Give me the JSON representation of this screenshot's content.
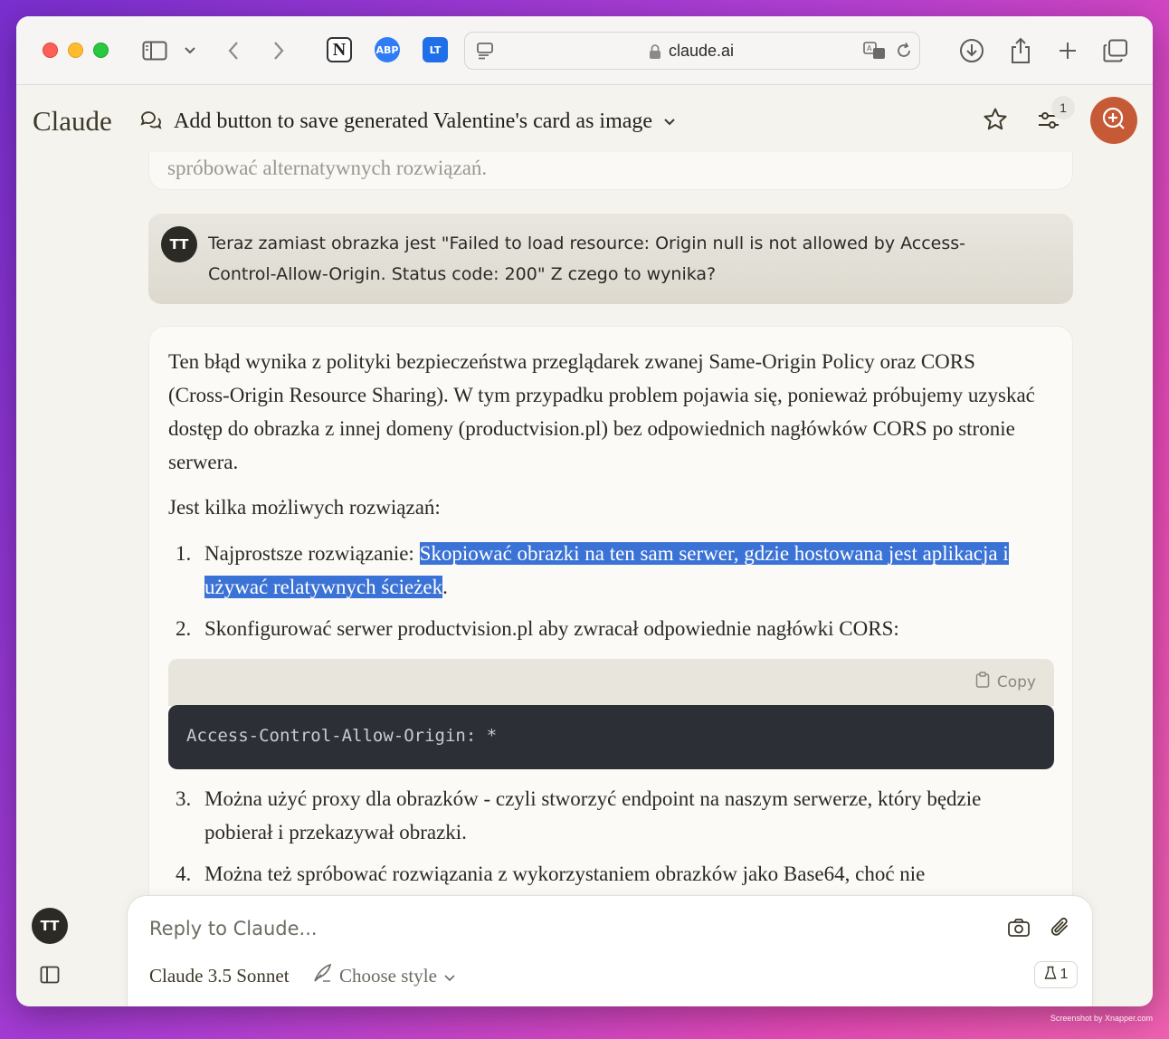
{
  "browser": {
    "url": "claude.ai",
    "extensions": [
      "notion-icon",
      "adblock-plus-icon",
      "languagetool-icon"
    ],
    "abp_label": "ABP",
    "lt_label": "LT"
  },
  "app": {
    "brand": "Claude",
    "chat_title": "Add button to save generated Valentine's card as image",
    "tune_badge": "1",
    "accent": "#c65a36"
  },
  "conversation": {
    "previous_tail": "spróbować alternatywnych rozwiązań.",
    "user": {
      "initials": "TT",
      "text": "Teraz zamiast obrazka jest \"Failed to load resource: Origin null is not allowed by Access-Control-Allow-Origin. Status code: 200\" Z czego to wynika?"
    },
    "reply": {
      "paragraph1": "Ten błąd wynika z polityki bezpieczeństwa przeglądarek zwanej Same-Origin Policy oraz CORS (Cross-Origin Resource Sharing). W tym przypadku problem pojawia się, ponieważ próbujemy uzyskać dostęp do obrazka z innej domeny (productvision.pl) bez odpowiednich nagłówków CORS po stronie serwera.",
      "paragraph2": "Jest kilka możliwych rozwiązań:",
      "items": [
        {
          "num": "1.",
          "lead": "Najprostsze rozwiązanie: ",
          "highlighted": "Skopiować obrazki na ten sam serwer, gdzie hostowana jest aplikacja i używać relatywnych ścieżek",
          "tail": "."
        },
        {
          "num": "2.",
          "text": "Skonfigurować serwer productvision.pl aby zwracał odpowiednie nagłówki CORS:"
        },
        {
          "num": "3.",
          "text": "Można użyć proxy dla obrazków - czyli stworzyć endpoint na naszym serwerze, który będzie pobierał i przekazywał obrazki."
        },
        {
          "num": "4.",
          "text": "Można też spróbować rozwiązania z wykorzystaniem obrazków jako Base64, choć nie"
        }
      ],
      "code": {
        "copy_label": "Copy",
        "content": "Access-Control-Allow-Origin: *"
      }
    }
  },
  "composer": {
    "placeholder": "Reply to Claude...",
    "model": "Claude 3.5 Sonnet",
    "style_label": "Choose style",
    "counter": "1"
  },
  "user_avatar": "TT",
  "watermark": "Screenshot by Xnapper.com"
}
